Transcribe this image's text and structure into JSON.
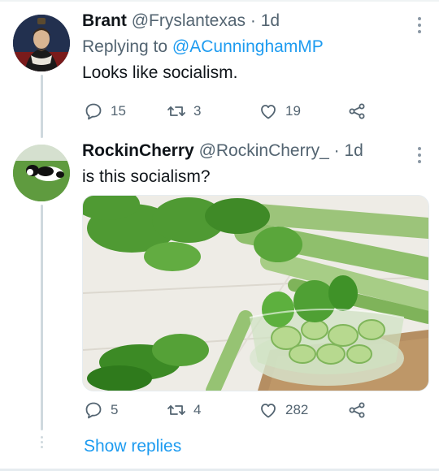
{
  "tweets": [
    {
      "name": "Brant",
      "handle": "@Fryslantexas",
      "sep": "·",
      "age": "1d",
      "replying_prefix": "Replying to ",
      "replying_handle": "@ACunninghamMP",
      "text": "Looks like socialism.",
      "replies": "15",
      "retweets": "3",
      "likes": "19"
    },
    {
      "name": "RockinCherry",
      "handle": "@RockinCherry_",
      "sep": "·",
      "age": "1d",
      "text": "is this socialism?",
      "replies": "5",
      "retweets": "4",
      "likes": "282"
    }
  ],
  "show_replies": "Show replies",
  "icons": {
    "reply": "reply-icon",
    "retweet": "retweet-icon",
    "like": "like-icon",
    "share": "share-icon",
    "more": "more-icon"
  },
  "colors": {
    "link": "#1d9bf0",
    "secondary_text": "#536471",
    "thread_line": "#cfd9de"
  }
}
